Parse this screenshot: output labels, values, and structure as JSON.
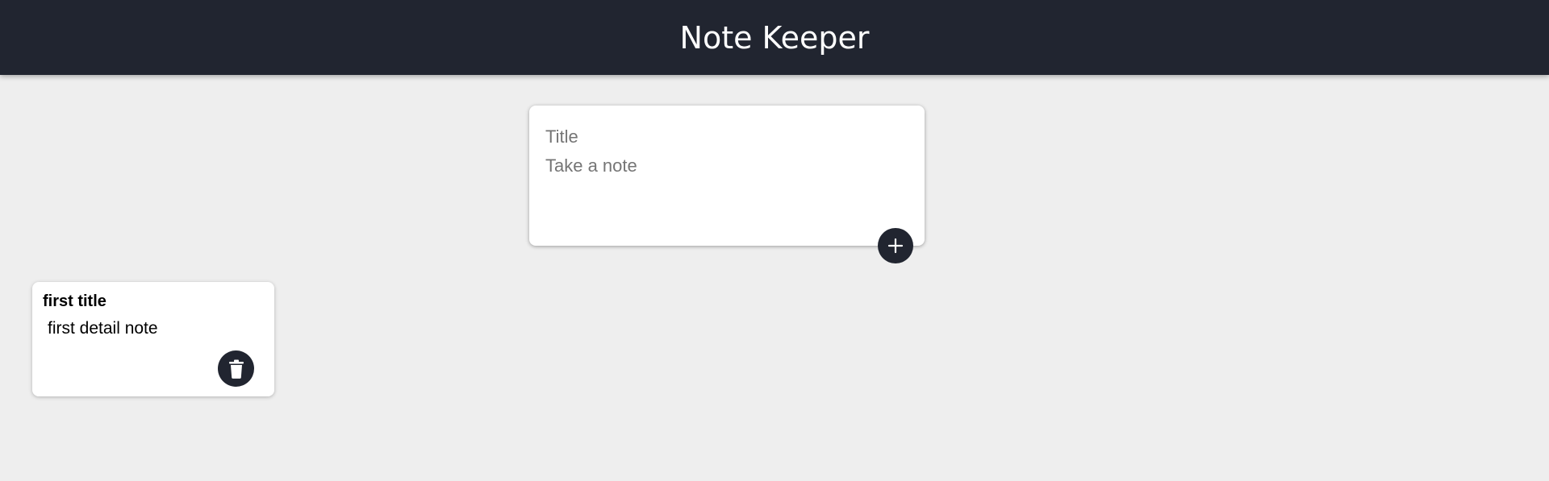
{
  "header": {
    "title": "Note Keeper"
  },
  "create_note": {
    "title_placeholder": "Title",
    "content_placeholder": "Take a note",
    "add_icon": "plus-icon"
  },
  "notes": [
    {
      "title": "first title",
      "content": "first detail note",
      "delete_icon": "trash-icon"
    }
  ],
  "colors": {
    "header_bg": "#212530",
    "page_bg": "#eeeeee",
    "button_bg": "#212530"
  }
}
